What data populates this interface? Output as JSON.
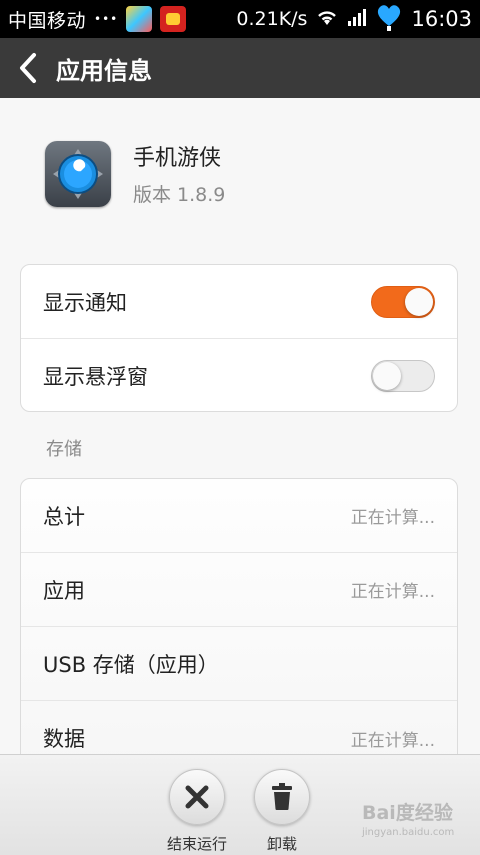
{
  "status_bar": {
    "carrier": "中国移动",
    "dots": "•••",
    "net_speed": "0.21K/s",
    "time": "16:03"
  },
  "title_bar": {
    "title": "应用信息"
  },
  "app": {
    "name": "手机游侠",
    "version": "版本 1.8.9"
  },
  "toggles": [
    {
      "label": "显示通知",
      "state": "on"
    },
    {
      "label": "显示悬浮窗",
      "state": "off"
    }
  ],
  "storage_section_label": "存储",
  "storage_rows": [
    {
      "label": "总计",
      "value": "正在计算..."
    },
    {
      "label": "应用",
      "value": "正在计算..."
    },
    {
      "label": "USB 存储（应用）",
      "value": ""
    },
    {
      "label": "数据",
      "value": "正在计算..."
    }
  ],
  "actions": {
    "kill_label": "结束运行",
    "uninstall_label": "卸载"
  },
  "watermark": {
    "brand": "Bai度经验",
    "url": "jingyan.baidu.com"
  },
  "colors": {
    "accent": "#f26a1b",
    "titlebar": "#3a3a3a"
  }
}
